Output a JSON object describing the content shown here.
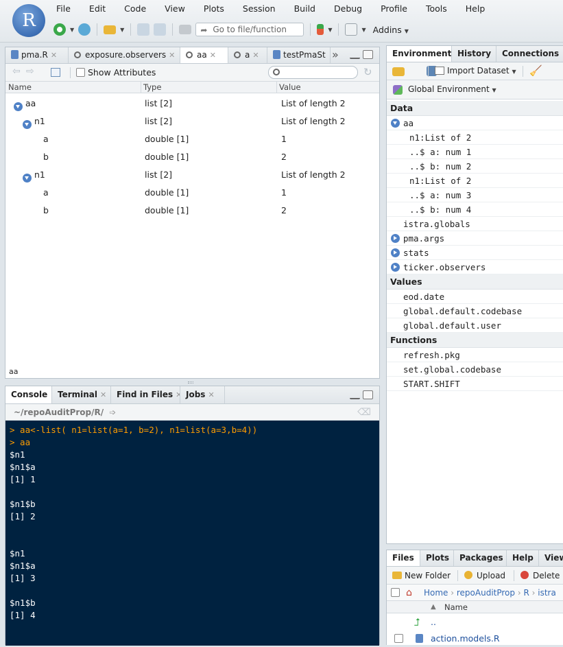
{
  "menubar": [
    "File",
    "Edit",
    "Code",
    "View",
    "Plots",
    "Session",
    "Build",
    "Debug",
    "Profile",
    "Tools",
    "Help"
  ],
  "logo_letter": "R",
  "toolbar": {
    "goto_placeholder": "Go to file/function",
    "addins_label": "Addins"
  },
  "viewer": {
    "tabs": [
      {
        "label": "pma.R",
        "kind": "file"
      },
      {
        "label": "exposure.observers",
        "kind": "view"
      },
      {
        "label": "aa",
        "kind": "view"
      },
      {
        "label": "a",
        "kind": "view"
      },
      {
        "label": "testPmaSt",
        "kind": "file"
      }
    ],
    "overflow_label": "»",
    "show_attributes_label": "Show Attributes",
    "columns": [
      "Name",
      "Type",
      "Value"
    ],
    "rows": [
      {
        "name": "aa",
        "type": "list [2]",
        "value": "List of length 2",
        "level": 0,
        "expandable": true
      },
      {
        "name": "n1",
        "type": "list [2]",
        "value": "List of length 2",
        "level": 1,
        "expandable": true
      },
      {
        "name": "a",
        "type": "double [1]",
        "value": "1",
        "level": 2,
        "expandable": false
      },
      {
        "name": "b",
        "type": "double [1]",
        "value": "2",
        "level": 2,
        "expandable": false
      },
      {
        "name": "n1",
        "type": "list [2]",
        "value": "List of length 2",
        "level": 1,
        "expandable": true
      },
      {
        "name": "a",
        "type": "double [1]",
        "value": "1",
        "level": 2,
        "expandable": false
      },
      {
        "name": "b",
        "type": "double [1]",
        "value": "2",
        "level": 2,
        "expandable": false
      }
    ],
    "status": "aa"
  },
  "console": {
    "tabs": [
      "Console",
      "Terminal",
      "Find in Files",
      "Jobs"
    ],
    "path": "~/repoAuditProp/R/",
    "lines": [
      {
        "text": "> aa<-list( n1=list(a=1, b=2), n1=list(a=3,b=4))",
        "type": "cmd"
      },
      {
        "text": "> aa",
        "type": "cmd"
      },
      {
        "text": "$n1",
        "type": "out"
      },
      {
        "text": "$n1$a",
        "type": "out"
      },
      {
        "text": "[1] 1",
        "type": "out"
      },
      {
        "text": "",
        "type": "out"
      },
      {
        "text": "$n1$b",
        "type": "out"
      },
      {
        "text": "[1] 2",
        "type": "out"
      },
      {
        "text": "",
        "type": "out"
      },
      {
        "text": "",
        "type": "out"
      },
      {
        "text": "$n1",
        "type": "out"
      },
      {
        "text": "$n1$a",
        "type": "out"
      },
      {
        "text": "[1] 3",
        "type": "out"
      },
      {
        "text": "",
        "type": "out"
      },
      {
        "text": "$n1$b",
        "type": "out"
      },
      {
        "text": "[1] 4",
        "type": "out"
      }
    ]
  },
  "environment": {
    "tabs": [
      "Environment",
      "History",
      "Connections"
    ],
    "import_label": "Import Dataset",
    "scope_label": "Global Environment",
    "sections": [
      {
        "title": "Data",
        "items": [
          {
            "text": "aa",
            "indent": 0,
            "icon": "expanded"
          },
          {
            "text": "n1:List of 2",
            "indent": 1,
            "icon": "none"
          },
          {
            "text": "..$ a: num 1",
            "indent": 1,
            "icon": "none"
          },
          {
            "text": "..$ b: num 2",
            "indent": 1,
            "icon": "none"
          },
          {
            "text": "n1:List of 2",
            "indent": 1,
            "icon": "none"
          },
          {
            "text": "..$ a: num 3",
            "indent": 1,
            "icon": "none"
          },
          {
            "text": "..$ b: num 4",
            "indent": 1,
            "icon": "none"
          },
          {
            "text": "istra.globals",
            "indent": 0,
            "icon": "blank"
          },
          {
            "text": "pma.args",
            "indent": 0,
            "icon": "collapsed"
          },
          {
            "text": "stats",
            "indent": 0,
            "icon": "collapsed"
          },
          {
            "text": "ticker.observers",
            "indent": 0,
            "icon": "collapsed"
          }
        ]
      },
      {
        "title": "Values",
        "items": [
          {
            "text": "eod.date",
            "indent": 0,
            "icon": "blank"
          },
          {
            "text": "global.default.codebase",
            "indent": 0,
            "icon": "blank"
          },
          {
            "text": "global.default.user",
            "indent": 0,
            "icon": "blank"
          }
        ]
      },
      {
        "title": "Functions",
        "items": [
          {
            "text": "refresh.pkg",
            "indent": 0,
            "icon": "blank"
          },
          {
            "text": "set.global.codebase",
            "indent": 0,
            "icon": "blank"
          },
          {
            "text": "START.SHIFT",
            "indent": 0,
            "icon": "blank"
          }
        ]
      }
    ]
  },
  "files": {
    "tabs": [
      "Files",
      "Plots",
      "Packages",
      "Help",
      "View"
    ],
    "new_folder_label": "New Folder",
    "upload_label": "Upload",
    "delete_label": "Delete",
    "breadcrumb": [
      "Home",
      "repoAuditProp",
      "R",
      "istra"
    ],
    "name_header": "Name",
    "rows": [
      {
        "name": "..",
        "kind": "up"
      },
      {
        "name": "action.models.R",
        "kind": "file"
      }
    ]
  },
  "colors": {
    "accent": "#4f81c6",
    "console_bg": "#002240",
    "console_cmd": "#ff9d00"
  }
}
